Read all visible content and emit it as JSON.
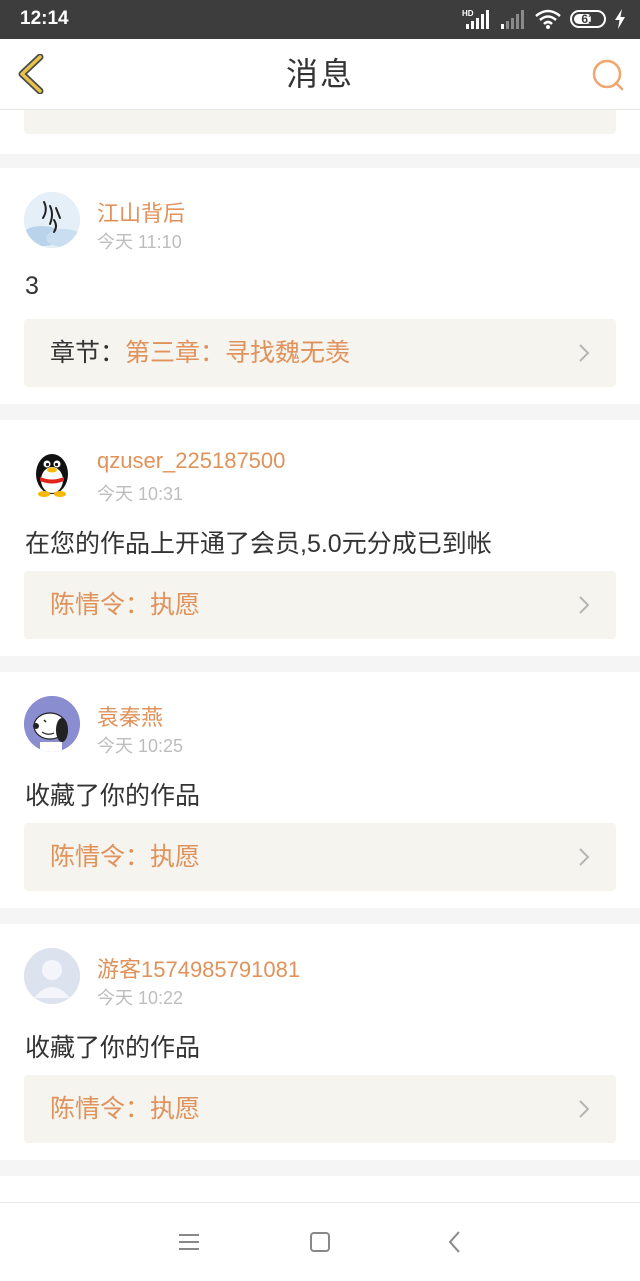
{
  "status_bar": {
    "time": "12:14",
    "network_label": "HD",
    "battery_level": "61",
    "icons": [
      "signal-icon",
      "signal-weak-icon",
      "wifi-icon",
      "battery-icon",
      "charging-icon"
    ]
  },
  "header": {
    "title": "消息",
    "back_icon": "chevron-left-icon",
    "search_icon": "search-icon"
  },
  "colors": {
    "accent": "#e0925a",
    "back_icon": "#c9a52e",
    "link_box_bg": "#f5f4ef",
    "text_primary": "#333333",
    "timestamp": "#bdbdbd"
  },
  "messages": [
    {
      "username": "江山背后",
      "time": "今天 11:10",
      "text": "3",
      "link_prefix": "章节：",
      "link_work": "第三章：寻找魏无羡",
      "avatar": "calligraphy-avatar"
    },
    {
      "username": "qzuser_225187500",
      "time": "今天 10:31",
      "text": "在您的作品上开通了会员,5.0元分成已到帐",
      "link_prefix": "",
      "link_work": "陈情令：执愿",
      "avatar": "penguin-avatar"
    },
    {
      "username": "袁秦燕",
      "time": "今天 10:25",
      "text": "收藏了你的作品",
      "link_prefix": "",
      "link_work": "陈情令：执愿",
      "avatar": "snoopy-avatar"
    },
    {
      "username": "游客1574985791081",
      "time": "今天 10:22",
      "text": "收藏了你的作品",
      "link_prefix": "",
      "link_work": "陈情令：执愿",
      "avatar": "default-user-avatar"
    }
  ],
  "nav_bar": {
    "icons": [
      "menu-icon",
      "home-icon",
      "back-icon"
    ]
  }
}
